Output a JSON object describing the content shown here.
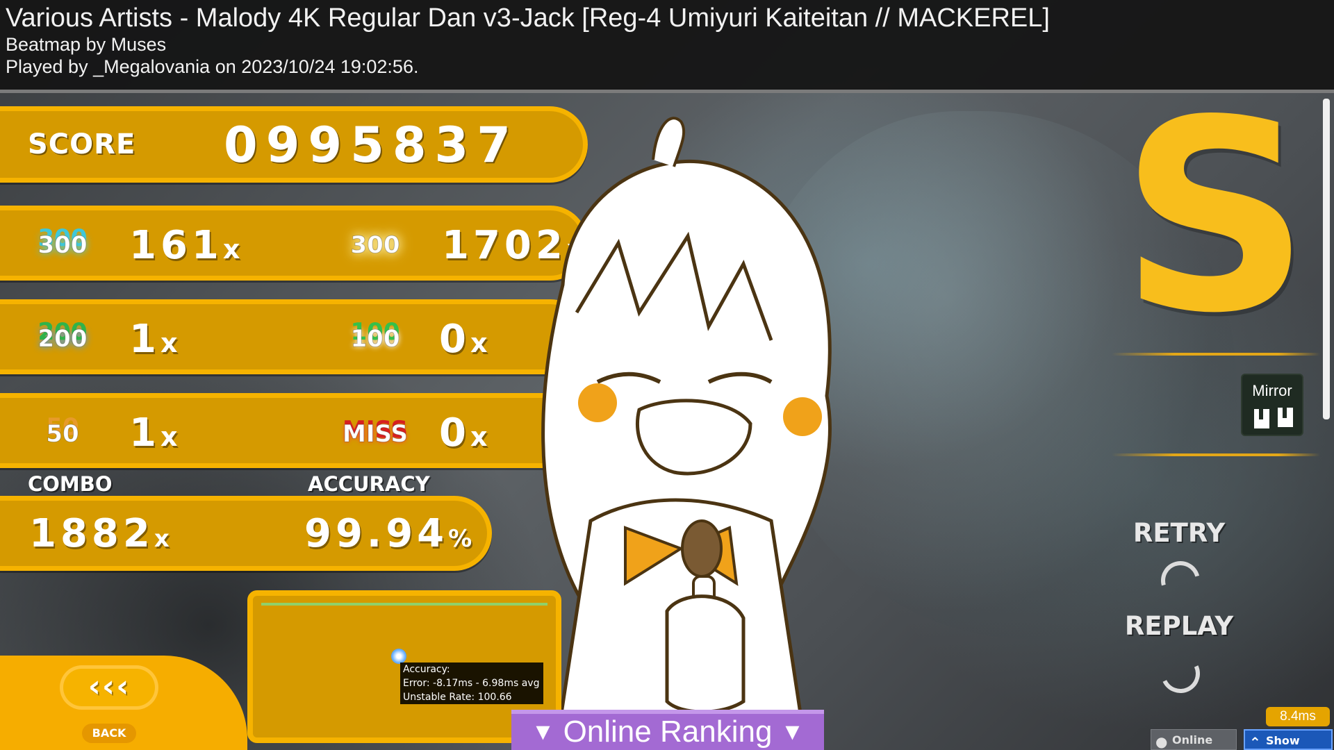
{
  "header": {
    "title": "Various Artists - Malody 4K Regular Dan v3-Jack [Reg-4 Umiyuri Kaiteitan // MACKEREL]",
    "beatmap_by": "Beatmap by Muses",
    "played_by": "Played by _Megalovania on 2023/10/24 19:02:56."
  },
  "score": {
    "label": "SCORE",
    "value": "0995837"
  },
  "judgements": {
    "j300": {
      "label": "300",
      "count": "161",
      "unit": "x"
    },
    "j300g": {
      "label": "300",
      "count": "1702",
      "unit": "x"
    },
    "j200": {
      "label": "200",
      "count": "1",
      "unit": "x"
    },
    "j100": {
      "label": "100",
      "count": "0",
      "unit": "x"
    },
    "j50": {
      "label": "50",
      "count": "1",
      "unit": "x"
    },
    "jmiss": {
      "label": "MISS",
      "count": "0",
      "unit": "x"
    }
  },
  "combo": {
    "label": "COMBO",
    "value": "1882",
    "unit": "x"
  },
  "accuracy": {
    "label": "ACCURACY",
    "value": "99.94",
    "unit": "%"
  },
  "rank": {
    "letter": "S",
    "color": "#f8be1c"
  },
  "mods": [
    {
      "label": "Mirror",
      "icon": "mirror-piano-keys-icon"
    }
  ],
  "actions": {
    "retry": "RETRY",
    "replay": "REPLAY",
    "back_arrows": "‹‹‹",
    "back": "BACK"
  },
  "hit_graph": {
    "tooltip_line1": "Accuracy:",
    "tooltip_line2": "Error: -8.17ms - 6.98ms avg",
    "tooltip_line3": "Unstable Rate: 100.66"
  },
  "online_ranking": {
    "label": "Online Ranking",
    "arrow": "▼"
  },
  "status": {
    "latency": "8.4ms"
  },
  "bottom": {
    "online_users": "Online Users",
    "show_chat": "Show Chat"
  },
  "colors": {
    "panel": "#d59a00",
    "panel_border": "#f6b300",
    "ranking": "#a36ad3",
    "chat": "#1b58b8"
  }
}
